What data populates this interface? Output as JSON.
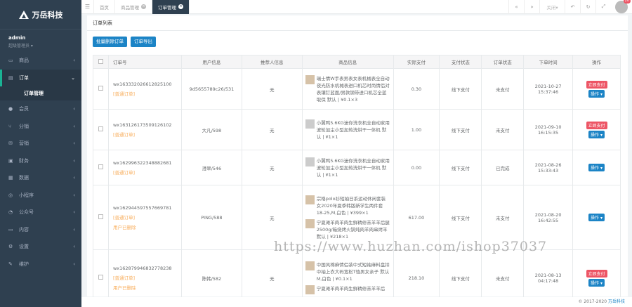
{
  "app": {
    "logo_text": "万岳科技",
    "user_name": "admin",
    "user_role": "超级管理员 ▾"
  },
  "menu": [
    {
      "icon": "▭",
      "label": "商品"
    },
    {
      "icon": "▤",
      "label": "订单",
      "active": true
    },
    {
      "icon": "",
      "label": "订单管理",
      "sub": true
    },
    {
      "icon": "●",
      "label": "会员"
    },
    {
      "icon": "⑂",
      "label": "分销"
    },
    {
      "icon": "✉",
      "label": "营销"
    },
    {
      "icon": "▣",
      "label": "财务"
    },
    {
      "icon": "▦",
      "label": "数据"
    },
    {
      "icon": "◎",
      "label": "小程序"
    },
    {
      "icon": "◔",
      "label": "公众号"
    },
    {
      "icon": "▭",
      "label": "内容"
    },
    {
      "icon": "⚙",
      "label": "设置"
    },
    {
      "icon": "✎",
      "label": "维护"
    }
  ],
  "tabs": [
    {
      "label": "首页"
    },
    {
      "label": "商品管理"
    },
    {
      "label": "订单管理",
      "active": true
    }
  ],
  "topright": {
    "close_label": "关闭▾",
    "badge": "20"
  },
  "page": {
    "title": "订单列表",
    "batch_delete": "批量删除订单",
    "order_export": "订单导出"
  },
  "table": {
    "headers": [
      "订单号",
      "用户信息",
      "推荐人信息",
      "商品信息",
      "实际支付",
      "支付状态",
      "订单状态",
      "下单时间",
      "操作"
    ],
    "rows": [
      {
        "order_no": "wx163332026612825100",
        "tag": "[普通订单]",
        "user": "9d5655789c26/531",
        "ref": "无",
        "products": [
          {
            "t": "瑞士情W手表男表女表机械表全自动夜光防水机械表进口机芯时尚情侣对表镶钉蓝面/男款钢带进口机芯全蓝取保 默认 | ¥0.1×3"
          }
        ],
        "paid": "0.30",
        "pay": "线下支付",
        "status": "未支付",
        "date": "2021-10-27",
        "time": "15:37:46",
        "pay_btn": "立即支付",
        "op": "操作"
      },
      {
        "order_no": "wx163126173509126102",
        "tag": "[普通订单]",
        "user": "大凡/598",
        "ref": "无",
        "products": [
          {
            "t": "小翼鸭5.6KG迷你洗衣机全自动家用波轮加尘小型加热洗烘干一体机 默认 | ¥1×1",
            "g": true
          }
        ],
        "paid": "1.00",
        "pay": "线下支付",
        "status": "未支付",
        "date": "2021-09-10",
        "time": "16:15:35",
        "pay_btn": "立即支付",
        "op": "操作"
      },
      {
        "order_no": "wx162996322348882681",
        "tag": "[普通订单]",
        "user": "澄翠/546",
        "ref": "无",
        "products": [
          {
            "t": "小翼鸭5.6KG迷你洗衣机全自动家用波轮加尘小型加热洗烘干一体机 默认 | ¥1×1",
            "g": true
          }
        ],
        "paid": "0.00",
        "pay": "线下支付",
        "status": "已完成",
        "date": "2021-08-26",
        "time": "15:33:43",
        "op": "操作"
      },
      {
        "order_no": "wx162944597557669781",
        "tag": "[普通订单]",
        "extra": "用户已删除",
        "user": "PING/588",
        "ref": "无",
        "products": [
          {
            "t": "宗格polo衫短袖日系运动休闲套装女2020年夏季韩版新学生两件套 18-25,M,白色 | ¥399×1"
          },
          {
            "t": "宁夏滩羊肉羊肉生鲜精修羔羊羊后腿2500g/箱烧烤火锅炖肉羊肉串烤羊 默认 | ¥218×1"
          }
        ],
        "paid": "617.00",
        "pay": "线下支付",
        "status": "未支付",
        "date": "2021-08-20",
        "time": "16:42:55",
        "op": "操作"
      },
      {
        "order_no": "wx162879946832778238",
        "tag": "[普通订单]",
        "extra": "用户已删除",
        "user": "陈韩/582",
        "ref": "无",
        "products": [
          {
            "t": "中国风棉麻情侣装中式短袖麻料盘扣中袖上衣大码宽松T恤男女亲子 默认 M,白色 | ¥0.1×1"
          },
          {
            "t": "宁夏滩羊肉羊肉生鲜精修羔羊羊后"
          }
        ],
        "paid": "218.10",
        "pay": "线下支付",
        "status": "未支付",
        "date": "2021-08-13",
        "time": "04:17:48",
        "pay_btn": "立即支付",
        "op": "操作"
      }
    ]
  },
  "watermark": "https://www.huzhan.com/ishop37037",
  "footer": {
    "copyright": "© 2017-2020",
    "brand": "万岳科技"
  }
}
